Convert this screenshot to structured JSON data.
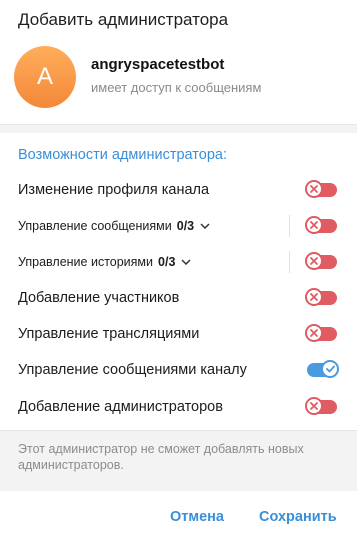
{
  "dialog": {
    "title": "Добавить администратора",
    "user": {
      "avatar_letter": "A",
      "name": "angryspacetestbot",
      "status": "имеет доступ к сообщениям"
    },
    "section_title": "Возможности администратора:",
    "permissions": [
      {
        "label": "Изменение профиля канала",
        "enabled": false
      },
      {
        "label": "Управление сообщениями",
        "count": "0/3",
        "expandable": true,
        "enabled": false
      },
      {
        "label": "Управление историями",
        "count": "0/3",
        "expandable": true,
        "enabled": false
      },
      {
        "label": "Добавление участников",
        "enabled": false
      },
      {
        "label": "Управление трансляциями",
        "enabled": false
      },
      {
        "label": "Управление сообщениями каналу",
        "enabled": true
      },
      {
        "label": "Добавление администраторов",
        "enabled": false
      }
    ],
    "note": "Этот администратор не сможет добавлять новых администраторов.",
    "buttons": {
      "cancel": "Отмена",
      "save": "Сохранить"
    },
    "colors": {
      "accent": "#3a8fd9",
      "toggle_off": "#e05b62",
      "toggle_on": "#4a9ae0",
      "avatar": "#f59342"
    }
  }
}
